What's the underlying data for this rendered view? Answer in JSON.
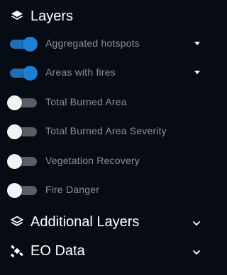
{
  "layers_section": {
    "title": "Layers",
    "icon": "layers-icon"
  },
  "layers": [
    {
      "label": "Aggregated hotspots",
      "enabled": true,
      "has_dropdown": true
    },
    {
      "label": "Areas with fires",
      "enabled": true,
      "has_dropdown": true
    },
    {
      "label": "Total Burned Area",
      "enabled": false,
      "has_dropdown": false
    },
    {
      "label": "Total Burned Area Severity",
      "enabled": false,
      "has_dropdown": false
    },
    {
      "label": "Vegetation Recovery",
      "enabled": false,
      "has_dropdown": false
    },
    {
      "label": "Fire Danger",
      "enabled": false,
      "has_dropdown": false
    }
  ],
  "additional_layers_section": {
    "title": "Additional Layers",
    "icon": "layers-outline-icon",
    "chevron": "chevron-down-icon"
  },
  "eo_data_section": {
    "title": "EO Data",
    "icon": "satellite-icon",
    "chevron": "chevron-down-icon"
  },
  "colors": {
    "background": "#070b13",
    "toggle_on": "#1e7fd6",
    "toggle_off_track": "#5a5d63",
    "label_text": "#8d9097",
    "header_text": "#ffffff"
  }
}
